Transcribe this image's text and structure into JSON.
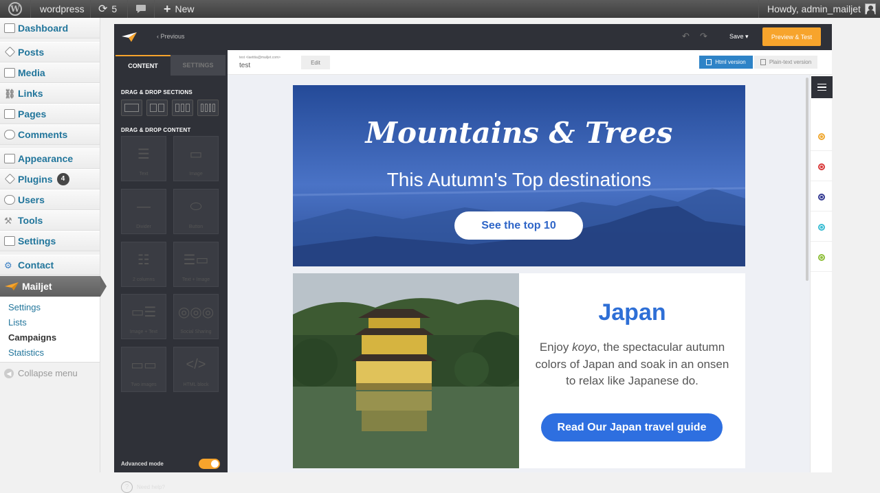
{
  "adminbar": {
    "site_name": "wordpress",
    "updates_count": "5",
    "new_label": "New",
    "howdy": "Howdy, admin_mailjet"
  },
  "sidebar": {
    "items": [
      {
        "label": "Dashboard",
        "icon": "dashboard-icon"
      },
      {
        "label": "Posts",
        "icon": "pin-icon"
      },
      {
        "label": "Media",
        "icon": "media-icon"
      },
      {
        "label": "Links",
        "icon": "link-icon"
      },
      {
        "label": "Pages",
        "icon": "pages-icon"
      },
      {
        "label": "Comments",
        "icon": "comment-icon"
      },
      {
        "label": "Appearance",
        "icon": "appearance-icon"
      },
      {
        "label": "Plugins",
        "icon": "plugin-icon",
        "badge": "4"
      },
      {
        "label": "Users",
        "icon": "users-icon"
      },
      {
        "label": "Tools",
        "icon": "tools-icon"
      },
      {
        "label": "Settings",
        "icon": "settings-icon"
      },
      {
        "label": "Contact",
        "icon": "contact-icon"
      },
      {
        "label": "Mailjet",
        "icon": "mailjet-icon"
      }
    ],
    "submenu": [
      "Settings",
      "Lists",
      "Campaigns",
      "Statistics"
    ],
    "collapse": "Collapse menu"
  },
  "editor": {
    "previous": "‹ Previous",
    "save": "Save ▾",
    "preview": "Preview & Test",
    "tabs": {
      "content": "CONTENT",
      "settings": "SETTINGS"
    },
    "sections_heading": "DRAG & DROP SECTIONS",
    "content_heading": "DRAG & DROP CONTENT",
    "tiles": [
      "Text",
      "Image",
      "Divider",
      "Button",
      "2 columns",
      "Text + Image",
      "Image + Text",
      "Social Sharing",
      "Two images",
      "HTML block"
    ],
    "advanced_mode": "Advanced mode",
    "need_help": "Need help?",
    "from": "test <laetitia@mailjet.com>",
    "subject": "test",
    "edit": "Edit",
    "html_version": "Html version",
    "plain_version": "Plain-text version"
  },
  "email": {
    "hero_title": "Mountains & Trees",
    "hero_subtitle": "This Autumn's Top destinations",
    "hero_button": "See the top 10",
    "japan_title": "Japan",
    "japan_text_1": "Enjoy ",
    "japan_text_em": "koyo",
    "japan_text_2": ", the spectacular autumn colors of Japan and soak in an onsen to relax like Japanese do.",
    "japan_button": "Read Our Japan travel guide"
  },
  "rail_colors": [
    "#f0a830",
    "#d93a3a",
    "#343a92",
    "#3bbdd4",
    "#8fbf3a"
  ]
}
